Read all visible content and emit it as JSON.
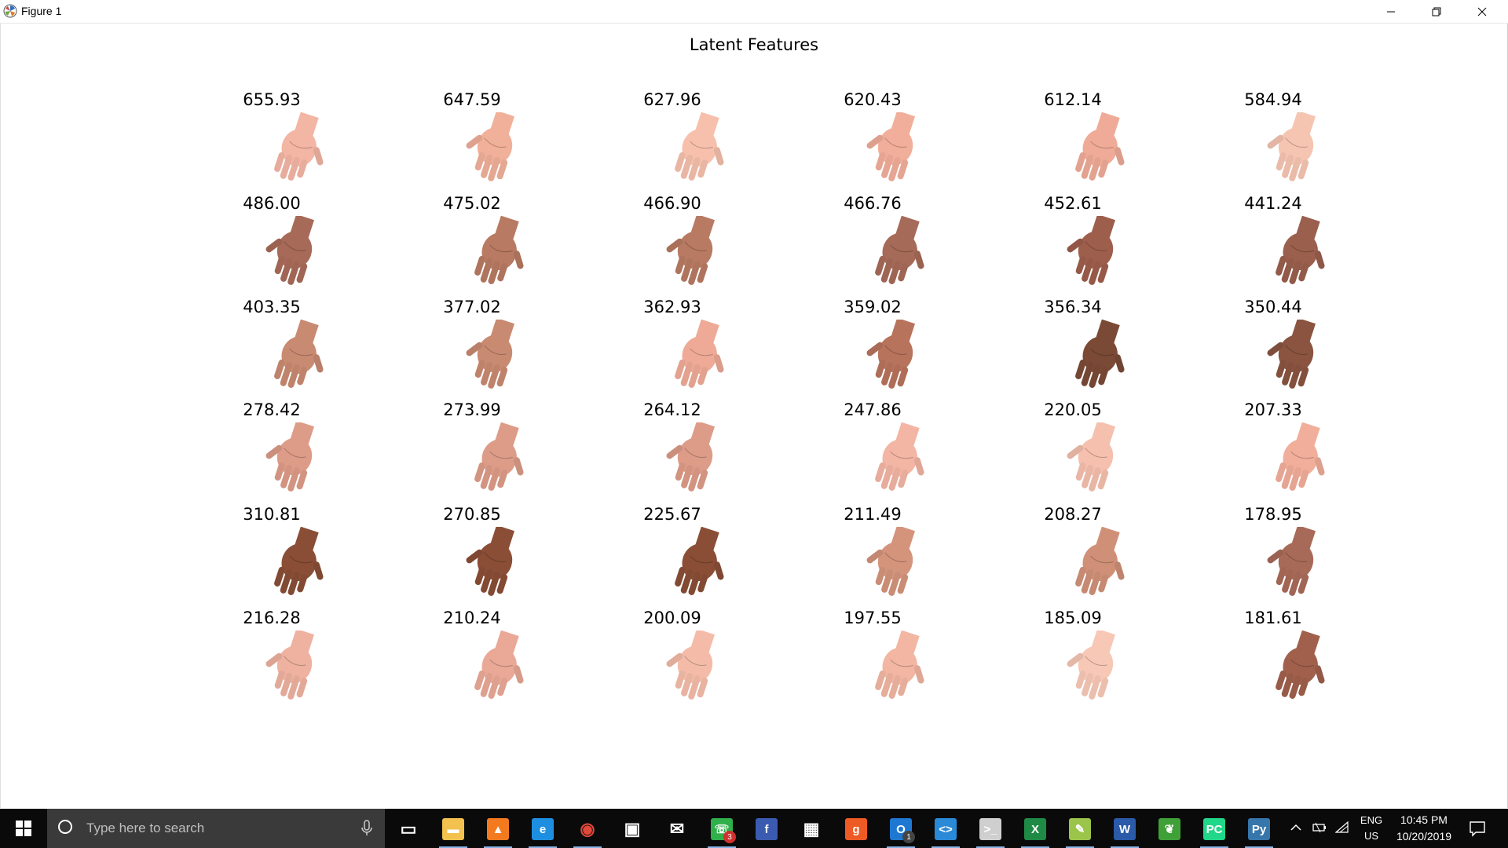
{
  "window": {
    "title": "Figure 1",
    "icons": {
      "app": "matplotlib-icon",
      "minimize": "minimize-icon",
      "maximize": "restore-icon",
      "close": "close-icon"
    }
  },
  "figure": {
    "title": "Latent Features",
    "rows": [
      [
        "655.93",
        "647.59",
        "627.96",
        "620.43",
        "612.14",
        "584.94"
      ],
      [
        "486.00",
        "475.02",
        "466.90",
        "466.76",
        "452.61",
        "441.24"
      ],
      [
        "403.35",
        "377.02",
        "362.93",
        "359.02",
        "356.34",
        "350.44"
      ],
      [
        "278.42",
        "273.99",
        "264.12",
        "247.86",
        "220.05",
        "207.33"
      ],
      [
        "310.81",
        "270.85",
        "225.67",
        "211.49",
        "208.27",
        "178.95"
      ],
      [
        "216.28",
        "210.24",
        "200.09",
        "197.55",
        "185.09",
        "181.61"
      ]
    ],
    "image_content": "hand-photo",
    "skin_tones": [
      [
        "#f3b5a4",
        "#f0b09a",
        "#f6c0ad",
        "#f1ae9a",
        "#efab98",
        "#f6c5b2"
      ],
      [
        "#a86a58",
        "#b87a62",
        "#b87a62",
        "#a66a58",
        "#9e5e4c",
        "#9a5f4d"
      ],
      [
        "#c98a72",
        "#c98a72",
        "#eeaa96",
        "#b8735d",
        "#7a4a36",
        "#8a5440"
      ],
      [
        "#dd9c88",
        "#dd9c88",
        "#dd9c88",
        "#f3b5a4",
        "#f5c0ae",
        "#f1ae9a"
      ],
      [
        "#8a4e36",
        "#8a4e36",
        "#8a4e36",
        "#d4947c",
        "#d09078",
        "#a86a58"
      ],
      [
        "#efb2a0",
        "#eaa896",
        "#f4bca8",
        "#f2b6a2",
        "#f7c8b6",
        "#a0604c"
      ]
    ]
  },
  "taskbar": {
    "search_placeholder": "Type here to search",
    "apps": [
      {
        "name": "task-view",
        "icon": "task-view-icon"
      },
      {
        "name": "file-explorer",
        "icon": "folder-icon",
        "color": "#f2c14e"
      },
      {
        "name": "vlc",
        "icon": "vlc-cone-icon",
        "color": "#f47a20"
      },
      {
        "name": "edge",
        "icon": "edge-icon",
        "color": "#1e8fe0"
      },
      {
        "name": "chrome",
        "icon": "chrome-icon"
      },
      {
        "name": "store",
        "icon": "store-icon",
        "color": "#ffffff"
      },
      {
        "name": "mail",
        "icon": "mail-icon",
        "color": "#ffffff"
      },
      {
        "name": "whatsapp",
        "icon": "whatsapp-icon",
        "color": "#2fb04a",
        "badge": "3"
      },
      {
        "name": "facebook",
        "icon": "facebook-icon",
        "color": "#3b5bb0"
      },
      {
        "name": "calculator",
        "icon": "calculator-icon",
        "color": "#ffffff"
      },
      {
        "name": "grammarly",
        "icon": "grammarly-icon",
        "color": "#ee5a24"
      },
      {
        "name": "outlook",
        "icon": "outlook-icon",
        "color": "#1e78d2",
        "badge": "1"
      },
      {
        "name": "vscode",
        "icon": "vscode-icon",
        "color": "#2a8ad8"
      },
      {
        "name": "terminal",
        "icon": "terminal-icon",
        "color": "#cfcfcf"
      },
      {
        "name": "excel",
        "icon": "excel-icon",
        "color": "#1f8a45"
      },
      {
        "name": "notepad-plus",
        "icon": "notepad-plus-icon",
        "color": "#9bc44a"
      },
      {
        "name": "word",
        "icon": "word-icon",
        "color": "#2a5aa8"
      },
      {
        "name": "mongodb",
        "icon": "mongodb-leaf-icon",
        "color": "#3fa037"
      },
      {
        "name": "pycharm",
        "icon": "pycharm-icon",
        "color": "#21d789"
      },
      {
        "name": "python",
        "icon": "python-icon",
        "color": "#3776ab"
      }
    ],
    "tray": {
      "lang": "ENG",
      "region": "US",
      "time": "10:45 PM",
      "date": "10/20/2019"
    }
  }
}
